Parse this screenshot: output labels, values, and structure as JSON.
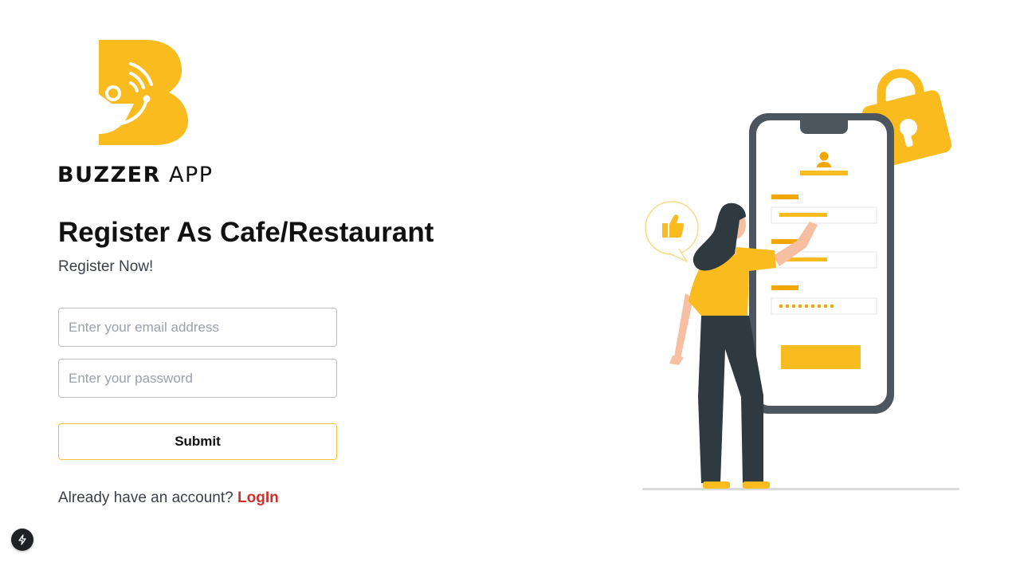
{
  "brand": {
    "name_bold": "BUZZER",
    "name_light": "APP"
  },
  "header": {
    "title": "Register As Cafe/Restaurant",
    "subtitle": "Register Now!"
  },
  "form": {
    "email_placeholder": "Enter your email address",
    "email_value": "",
    "password_placeholder": "Enter your password",
    "password_value": "",
    "submit_label": "Submit"
  },
  "footer": {
    "prompt": "Already have an account?",
    "login_label": "LogIn"
  },
  "icons": {
    "logo": "buzzer-b-logo-icon",
    "illustration": "woman-registering-on-phone-illustration",
    "fab": "lightning-icon"
  },
  "colors": {
    "accent": "#f9bb1e",
    "link": "#d0312d",
    "text": "#111111",
    "muted": "#3b3f4a"
  }
}
